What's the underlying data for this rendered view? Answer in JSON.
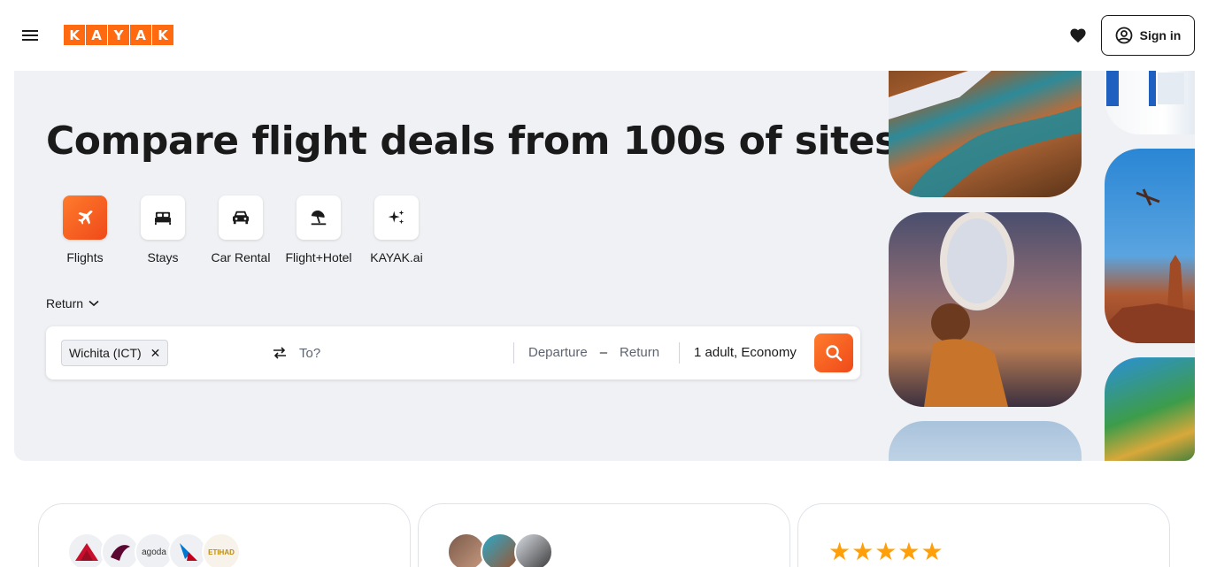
{
  "header": {
    "logo_letters": [
      "K",
      "A",
      "Y",
      "A",
      "K"
    ],
    "signin_label": "Sign in",
    "brand_color": "#ff690f"
  },
  "hero": {
    "title": "Compare flight deals from 100s of sites",
    "title_dot": ".",
    "verticals": [
      {
        "label": "Flights",
        "icon": "plane-icon",
        "active": true
      },
      {
        "label": "Stays",
        "icon": "bed-icon",
        "active": false
      },
      {
        "label": "Car Rental",
        "icon": "car-icon",
        "active": false
      },
      {
        "label": "Flight+Hotel",
        "icon": "beach-umbrella-icon",
        "active": false
      },
      {
        "label": "KAYAK.ai",
        "icon": "sparkles-icon",
        "active": false
      }
    ],
    "trip_type": "Return"
  },
  "search": {
    "origin": "Wichita (ICT)",
    "destination_placeholder": "To?",
    "departure_placeholder": "Departure",
    "date_separator": "–",
    "return_placeholder": "Return",
    "travelers": "1 adult, Economy"
  },
  "cards": {
    "card1_avatars": [
      "delta-logo",
      "qatar-logo",
      "agoda-logo",
      "american-logo",
      "etihad-logo"
    ],
    "card1_avatar_text": {
      "agoda": "agoda",
      "etihad": "ETIHAD"
    },
    "card2_avatars": [
      "person-1",
      "person-2",
      "person-3"
    ],
    "card3_rating_stars": 5
  }
}
